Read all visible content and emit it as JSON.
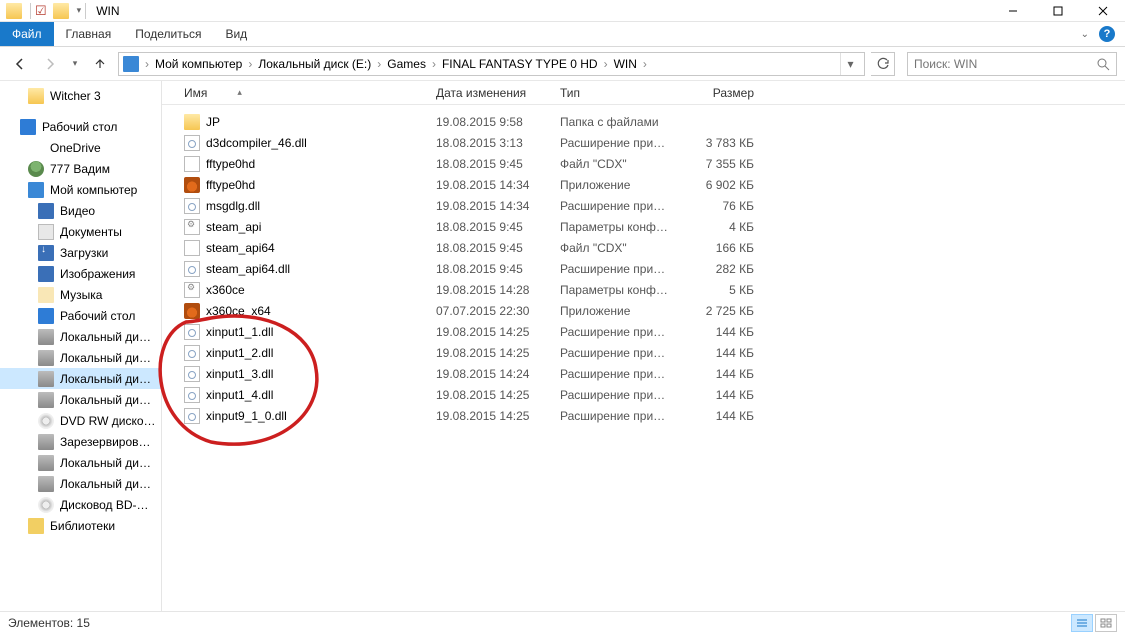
{
  "window": {
    "title": "WIN"
  },
  "ribbon": {
    "file": "Файл",
    "home": "Главная",
    "share": "Поделиться",
    "view": "Вид"
  },
  "breadcrumbs": {
    "items": [
      {
        "label": "Мой компьютер"
      },
      {
        "label": "Локальный диск (E:)"
      },
      {
        "label": "Games"
      },
      {
        "label": "FINAL FANTASY TYPE 0 HD"
      },
      {
        "label": "WIN"
      }
    ]
  },
  "search": {
    "placeholder": "Поиск: WIN"
  },
  "sidebar": {
    "items": [
      {
        "label": "Witcher 3",
        "icon": "folder",
        "indent": true
      },
      {
        "spacer": true
      },
      {
        "label": "Рабочий стол",
        "icon": "desktop",
        "indent": false
      },
      {
        "label": "OneDrive",
        "icon": "onedrive",
        "indent": true
      },
      {
        "label": "777 Вадим",
        "icon": "user",
        "indent": true
      },
      {
        "label": "Мой компьютер",
        "icon": "pc",
        "indent": true
      },
      {
        "label": "Видео",
        "icon": "video",
        "indent": true,
        "deep": true
      },
      {
        "label": "Документы",
        "icon": "doc",
        "indent": true,
        "deep": true
      },
      {
        "label": "Загрузки",
        "icon": "down",
        "indent": true,
        "deep": true
      },
      {
        "label": "Изображения",
        "icon": "img",
        "indent": true,
        "deep": true
      },
      {
        "label": "Музыка",
        "icon": "music",
        "indent": true,
        "deep": true
      },
      {
        "label": "Рабочий стол",
        "icon": "desktop",
        "indent": true,
        "deep": true
      },
      {
        "label": "Локальный ди…",
        "icon": "drive",
        "indent": true,
        "deep": true
      },
      {
        "label": "Локальный ди…",
        "icon": "drive",
        "indent": true,
        "deep": true
      },
      {
        "label": "Локальный ди…",
        "icon": "drive",
        "indent": true,
        "deep": true,
        "sel": true
      },
      {
        "label": "Локальный ди…",
        "icon": "drive",
        "indent": true,
        "deep": true
      },
      {
        "label": "DVD RW диско…",
        "icon": "dvd",
        "indent": true,
        "deep": true
      },
      {
        "label": "Зарезервиров…",
        "icon": "drive",
        "indent": true,
        "deep": true
      },
      {
        "label": "Локальный ди…",
        "icon": "drive",
        "indent": true,
        "deep": true
      },
      {
        "label": "Локальный ди…",
        "icon": "drive",
        "indent": true,
        "deep": true
      },
      {
        "label": "Дисковод BD-…",
        "icon": "dvd",
        "indent": true,
        "deep": true
      },
      {
        "label": "Библиотеки",
        "icon": "lib",
        "indent": true
      }
    ]
  },
  "columns": {
    "name": "Имя",
    "date": "Дата изменения",
    "type": "Тип",
    "size": "Размер"
  },
  "files": [
    {
      "name": "JP",
      "date": "19.08.2015 9:58",
      "type": "Папка с файлами",
      "size": "",
      "icon": "folder"
    },
    {
      "name": "d3dcompiler_46.dll",
      "date": "18.08.2015 3:13",
      "type": "Расширение при…",
      "size": "3 783 КБ",
      "icon": "dll"
    },
    {
      "name": "fftype0hd",
      "date": "18.08.2015 9:45",
      "type": "Файл \"CDX\"",
      "size": "7 355 КБ",
      "icon": "cdx"
    },
    {
      "name": "fftype0hd",
      "date": "19.08.2015 14:34",
      "type": "Приложение",
      "size": "6 902 КБ",
      "icon": "exe"
    },
    {
      "name": "msgdlg.dll",
      "date": "19.08.2015 14:34",
      "type": "Расширение при…",
      "size": "76 КБ",
      "icon": "dll"
    },
    {
      "name": "steam_api",
      "date": "18.08.2015 9:45",
      "type": "Параметры конф…",
      "size": "4 КБ",
      "icon": "cfg"
    },
    {
      "name": "steam_api64",
      "date": "18.08.2015 9:45",
      "type": "Файл \"CDX\"",
      "size": "166 КБ",
      "icon": "cdx"
    },
    {
      "name": "steam_api64.dll",
      "date": "18.08.2015 9:45",
      "type": "Расширение при…",
      "size": "282 КБ",
      "icon": "dll"
    },
    {
      "name": "x360ce",
      "date": "19.08.2015 14:28",
      "type": "Параметры конф…",
      "size": "5 КБ",
      "icon": "cfg"
    },
    {
      "name": "x360ce_x64",
      "date": "07.07.2015 22:30",
      "type": "Приложение",
      "size": "2 725 КБ",
      "icon": "exe"
    },
    {
      "name": "xinput1_1.dll",
      "date": "19.08.2015 14:25",
      "type": "Расширение при…",
      "size": "144 КБ",
      "icon": "dll"
    },
    {
      "name": "xinput1_2.dll",
      "date": "19.08.2015 14:25",
      "type": "Расширение при…",
      "size": "144 КБ",
      "icon": "dll"
    },
    {
      "name": "xinput1_3.dll",
      "date": "19.08.2015 14:24",
      "type": "Расширение при…",
      "size": "144 КБ",
      "icon": "dll"
    },
    {
      "name": "xinput1_4.dll",
      "date": "19.08.2015 14:25",
      "type": "Расширение при…",
      "size": "144 КБ",
      "icon": "dll"
    },
    {
      "name": "xinput9_1_0.dll",
      "date": "19.08.2015 14:25",
      "type": "Расширение при…",
      "size": "144 КБ",
      "icon": "dll"
    }
  ],
  "status": {
    "count_label": "Элементов: 15"
  }
}
